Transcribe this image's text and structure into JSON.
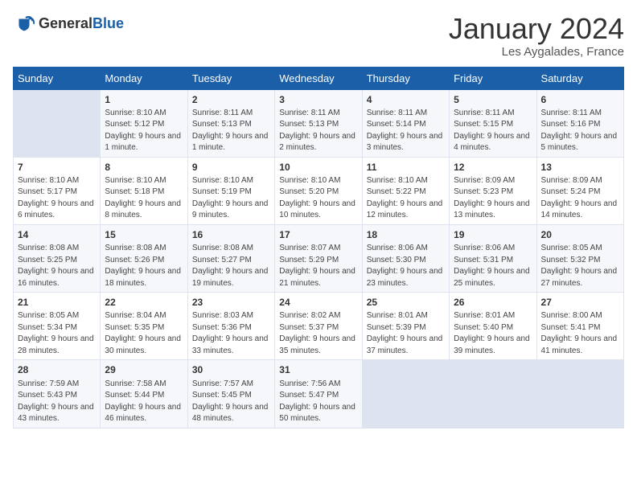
{
  "header": {
    "logo_general": "General",
    "logo_blue": "Blue",
    "month_title": "January 2024",
    "location": "Les Aygalades, France"
  },
  "days_of_week": [
    "Sunday",
    "Monday",
    "Tuesday",
    "Wednesday",
    "Thursday",
    "Friday",
    "Saturday"
  ],
  "weeks": [
    [
      {
        "day": "",
        "sunrise": "",
        "sunset": "",
        "daylight": "",
        "empty": true
      },
      {
        "day": "1",
        "sunrise": "Sunrise: 8:10 AM",
        "sunset": "Sunset: 5:12 PM",
        "daylight": "Daylight: 9 hours and 1 minute."
      },
      {
        "day": "2",
        "sunrise": "Sunrise: 8:11 AM",
        "sunset": "Sunset: 5:13 PM",
        "daylight": "Daylight: 9 hours and 1 minute."
      },
      {
        "day": "3",
        "sunrise": "Sunrise: 8:11 AM",
        "sunset": "Sunset: 5:13 PM",
        "daylight": "Daylight: 9 hours and 2 minutes."
      },
      {
        "day": "4",
        "sunrise": "Sunrise: 8:11 AM",
        "sunset": "Sunset: 5:14 PM",
        "daylight": "Daylight: 9 hours and 3 minutes."
      },
      {
        "day": "5",
        "sunrise": "Sunrise: 8:11 AM",
        "sunset": "Sunset: 5:15 PM",
        "daylight": "Daylight: 9 hours and 4 minutes."
      },
      {
        "day": "6",
        "sunrise": "Sunrise: 8:11 AM",
        "sunset": "Sunset: 5:16 PM",
        "daylight": "Daylight: 9 hours and 5 minutes."
      }
    ],
    [
      {
        "day": "7",
        "sunrise": "Sunrise: 8:10 AM",
        "sunset": "Sunset: 5:17 PM",
        "daylight": "Daylight: 9 hours and 6 minutes."
      },
      {
        "day": "8",
        "sunrise": "Sunrise: 8:10 AM",
        "sunset": "Sunset: 5:18 PM",
        "daylight": "Daylight: 9 hours and 8 minutes."
      },
      {
        "day": "9",
        "sunrise": "Sunrise: 8:10 AM",
        "sunset": "Sunset: 5:19 PM",
        "daylight": "Daylight: 9 hours and 9 minutes."
      },
      {
        "day": "10",
        "sunrise": "Sunrise: 8:10 AM",
        "sunset": "Sunset: 5:20 PM",
        "daylight": "Daylight: 9 hours and 10 minutes."
      },
      {
        "day": "11",
        "sunrise": "Sunrise: 8:10 AM",
        "sunset": "Sunset: 5:22 PM",
        "daylight": "Daylight: 9 hours and 12 minutes."
      },
      {
        "day": "12",
        "sunrise": "Sunrise: 8:09 AM",
        "sunset": "Sunset: 5:23 PM",
        "daylight": "Daylight: 9 hours and 13 minutes."
      },
      {
        "day": "13",
        "sunrise": "Sunrise: 8:09 AM",
        "sunset": "Sunset: 5:24 PM",
        "daylight": "Daylight: 9 hours and 14 minutes."
      }
    ],
    [
      {
        "day": "14",
        "sunrise": "Sunrise: 8:08 AM",
        "sunset": "Sunset: 5:25 PM",
        "daylight": "Daylight: 9 hours and 16 minutes."
      },
      {
        "day": "15",
        "sunrise": "Sunrise: 8:08 AM",
        "sunset": "Sunset: 5:26 PM",
        "daylight": "Daylight: 9 hours and 18 minutes."
      },
      {
        "day": "16",
        "sunrise": "Sunrise: 8:08 AM",
        "sunset": "Sunset: 5:27 PM",
        "daylight": "Daylight: 9 hours and 19 minutes."
      },
      {
        "day": "17",
        "sunrise": "Sunrise: 8:07 AM",
        "sunset": "Sunset: 5:29 PM",
        "daylight": "Daylight: 9 hours and 21 minutes."
      },
      {
        "day": "18",
        "sunrise": "Sunrise: 8:06 AM",
        "sunset": "Sunset: 5:30 PM",
        "daylight": "Daylight: 9 hours and 23 minutes."
      },
      {
        "day": "19",
        "sunrise": "Sunrise: 8:06 AM",
        "sunset": "Sunset: 5:31 PM",
        "daylight": "Daylight: 9 hours and 25 minutes."
      },
      {
        "day": "20",
        "sunrise": "Sunrise: 8:05 AM",
        "sunset": "Sunset: 5:32 PM",
        "daylight": "Daylight: 9 hours and 27 minutes."
      }
    ],
    [
      {
        "day": "21",
        "sunrise": "Sunrise: 8:05 AM",
        "sunset": "Sunset: 5:34 PM",
        "daylight": "Daylight: 9 hours and 28 minutes."
      },
      {
        "day": "22",
        "sunrise": "Sunrise: 8:04 AM",
        "sunset": "Sunset: 5:35 PM",
        "daylight": "Daylight: 9 hours and 30 minutes."
      },
      {
        "day": "23",
        "sunrise": "Sunrise: 8:03 AM",
        "sunset": "Sunset: 5:36 PM",
        "daylight": "Daylight: 9 hours and 33 minutes."
      },
      {
        "day": "24",
        "sunrise": "Sunrise: 8:02 AM",
        "sunset": "Sunset: 5:37 PM",
        "daylight": "Daylight: 9 hours and 35 minutes."
      },
      {
        "day": "25",
        "sunrise": "Sunrise: 8:01 AM",
        "sunset": "Sunset: 5:39 PM",
        "daylight": "Daylight: 9 hours and 37 minutes."
      },
      {
        "day": "26",
        "sunrise": "Sunrise: 8:01 AM",
        "sunset": "Sunset: 5:40 PM",
        "daylight": "Daylight: 9 hours and 39 minutes."
      },
      {
        "day": "27",
        "sunrise": "Sunrise: 8:00 AM",
        "sunset": "Sunset: 5:41 PM",
        "daylight": "Daylight: 9 hours and 41 minutes."
      }
    ],
    [
      {
        "day": "28",
        "sunrise": "Sunrise: 7:59 AM",
        "sunset": "Sunset: 5:43 PM",
        "daylight": "Daylight: 9 hours and 43 minutes."
      },
      {
        "day": "29",
        "sunrise": "Sunrise: 7:58 AM",
        "sunset": "Sunset: 5:44 PM",
        "daylight": "Daylight: 9 hours and 46 minutes."
      },
      {
        "day": "30",
        "sunrise": "Sunrise: 7:57 AM",
        "sunset": "Sunset: 5:45 PM",
        "daylight": "Daylight: 9 hours and 48 minutes."
      },
      {
        "day": "31",
        "sunrise": "Sunrise: 7:56 AM",
        "sunset": "Sunset: 5:47 PM",
        "daylight": "Daylight: 9 hours and 50 minutes."
      },
      {
        "day": "",
        "sunrise": "",
        "sunset": "",
        "daylight": "",
        "empty": true
      },
      {
        "day": "",
        "sunrise": "",
        "sunset": "",
        "daylight": "",
        "empty": true
      },
      {
        "day": "",
        "sunrise": "",
        "sunset": "",
        "daylight": "",
        "empty": true
      }
    ]
  ]
}
